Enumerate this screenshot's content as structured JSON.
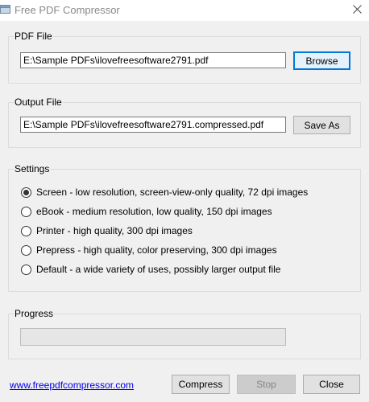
{
  "window": {
    "title": "Free PDF Compressor",
    "icon": "pdf-app-icon",
    "close_glyph": "✕"
  },
  "pdf_file": {
    "label": "PDF File",
    "value": "E:\\Sample PDFs\\ilovefreesoftware2791.pdf",
    "button": "Browse"
  },
  "output_file": {
    "label": "Output File",
    "value": "E:\\Sample PDFs\\ilovefreesoftware2791.compressed.pdf",
    "button": "Save As"
  },
  "settings": {
    "label": "Settings",
    "selected_index": 0,
    "options": [
      "Screen - low resolution, screen-view-only quality, 72 dpi images",
      "eBook - medium resolution, low quality, 150 dpi images",
      "Printer - high quality, 300 dpi images",
      "Prepress - high quality, color preserving, 300 dpi images",
      "Default - a wide variety of uses, possibly larger output file"
    ]
  },
  "progress": {
    "label": "Progress",
    "fraction": 0
  },
  "footer": {
    "link": "www.freepdfcompressor.com",
    "compress": "Compress",
    "stop": "Stop",
    "close": "Close"
  },
  "colors": {
    "accent": "#0078d7",
    "progress_fill": "#06b025",
    "link": "#0000ee"
  }
}
